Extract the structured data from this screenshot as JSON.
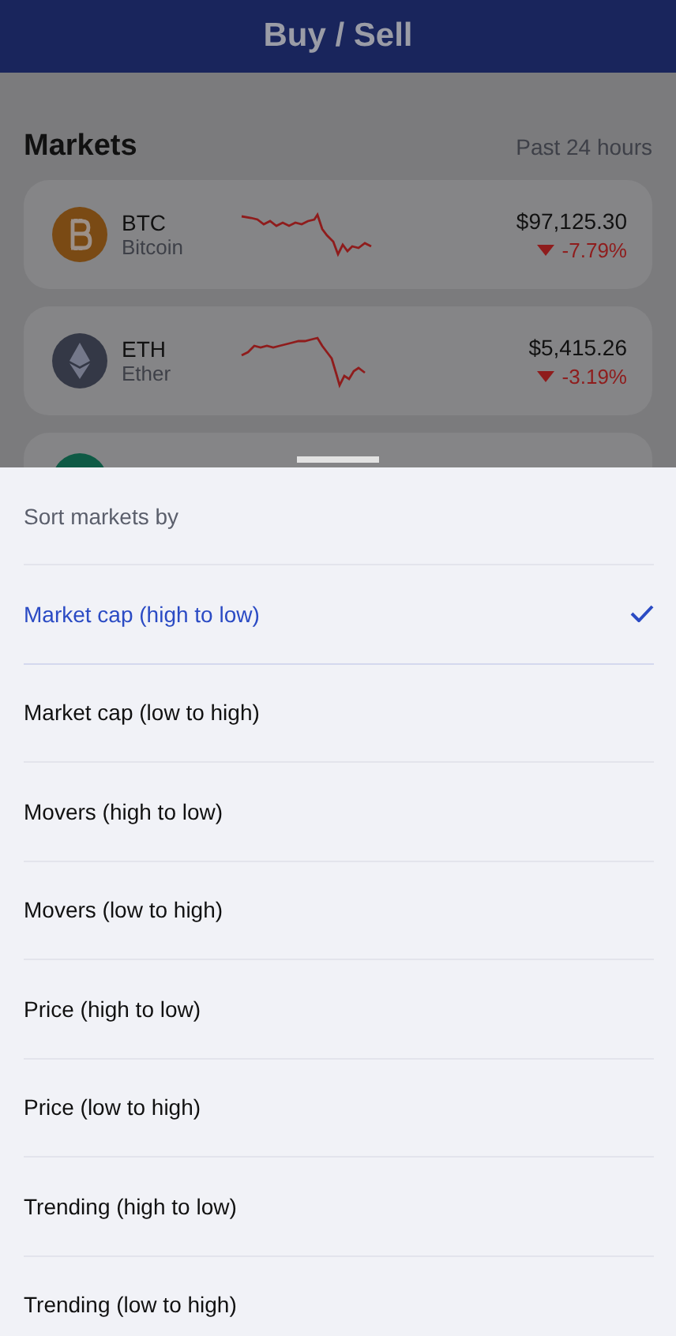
{
  "header": {
    "title": "Buy / Sell"
  },
  "markets": {
    "title": "Markets",
    "period": "Past 24 hours",
    "rows": [
      {
        "symbol": "BTC",
        "name": "Bitcoin",
        "price": "$97,125.30",
        "change": "-7.79%",
        "falling": true,
        "kind": "bitcoin",
        "color": "#7a4a14"
      },
      {
        "symbol": "ETH",
        "name": "Ether",
        "price": "$5,415.26",
        "change": "-3.19%",
        "falling": true,
        "kind": "ether",
        "color": "#343846"
      }
    ]
  },
  "sheet": {
    "title": "Sort markets by",
    "options": [
      {
        "label": "Market cap (high to low)",
        "selected": true
      },
      {
        "label": "Market cap (low to high)",
        "selected": false
      },
      {
        "label": "Movers (high to low)",
        "selected": false
      },
      {
        "label": "Movers (low to high)",
        "selected": false
      },
      {
        "label": "Price (high to low)",
        "selected": false
      },
      {
        "label": "Price (low to high)",
        "selected": false
      },
      {
        "label": "Trending (high to low)",
        "selected": false
      },
      {
        "label": "Trending (low to high)",
        "selected": false
      }
    ]
  }
}
